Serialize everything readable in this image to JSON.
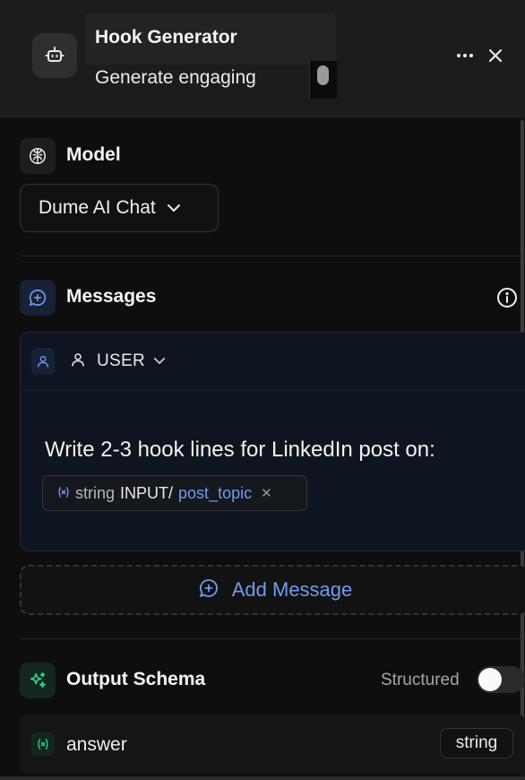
{
  "header": {
    "title": "Hook Generator",
    "subtitle": "Generate engaging",
    "icon": "robot-icon"
  },
  "model": {
    "section_label": "Model",
    "icon": "brain-icon",
    "selected": "Dume AI Chat"
  },
  "messages": {
    "section_label": "Messages",
    "icon": "message-plus-icon",
    "items": [
      {
        "role": "USER",
        "text": "Write 2-3 hook lines for LinkedIn post on:",
        "variable": {
          "type": "string",
          "source": "INPUT/",
          "name": "post_topic"
        }
      }
    ],
    "add_label": "Add Message"
  },
  "output_schema": {
    "section_label": "Output Schema",
    "icon": "sparkles-icon",
    "structured_label": "Structured",
    "structured_enabled": false,
    "fields": [
      {
        "name": "answer",
        "type": "string"
      }
    ]
  },
  "colors": {
    "accent_blue": "#6f9cf0",
    "accent_green": "#34d399",
    "background": "#0e0e0f"
  }
}
